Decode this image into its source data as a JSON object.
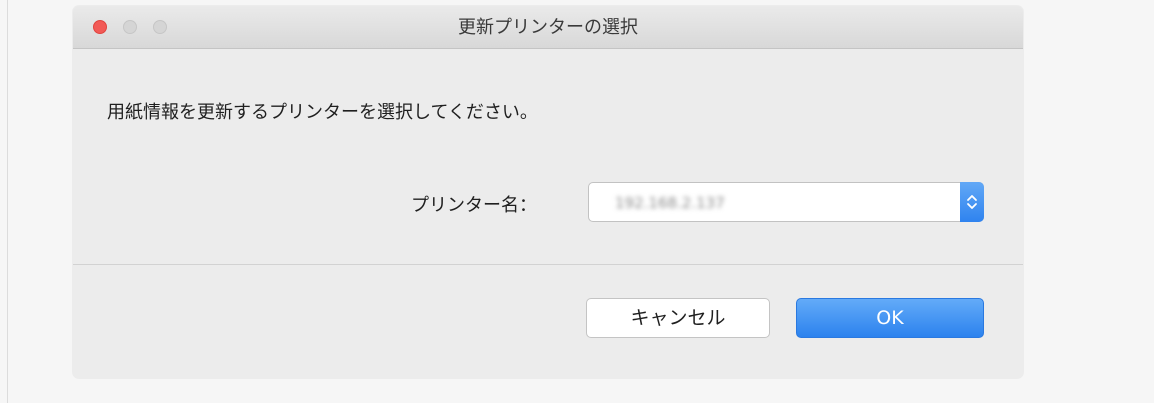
{
  "window": {
    "title": "更新プリンターの選択"
  },
  "dialog": {
    "message": "用紙情報を更新するプリンターを選択してください。",
    "printer_label": "プリンター名：",
    "printer_value": "192.168.2.137",
    "printer_value_obscured": true
  },
  "buttons": {
    "cancel_label": "キャンセル",
    "ok_label": "OK"
  },
  "colors": {
    "accent": "#2f83ef",
    "close": "#f25a56"
  },
  "icons": {
    "select_arrow": "chevron-up-down-icon"
  }
}
